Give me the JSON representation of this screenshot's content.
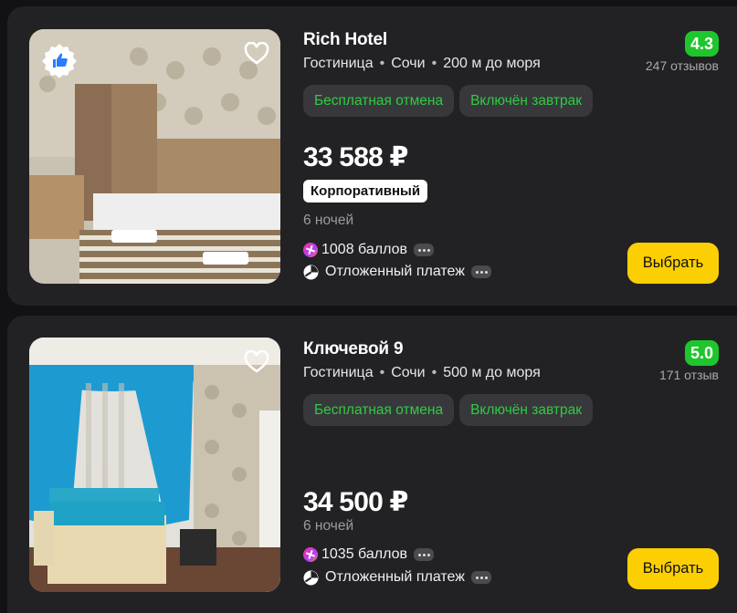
{
  "hotels": [
    {
      "name": "Rich Hotel",
      "type": "Гостиница",
      "city": "Сочи",
      "distance": "200 м до моря",
      "rating": "4.3",
      "reviews": "247 отзывов",
      "tags": [
        "Бесплатная отмена",
        "Включён завтрак"
      ],
      "price": "33 588 ₽",
      "badge": "Корпоративный",
      "nights": "6 ночей",
      "bonus": "1008 баллов",
      "payment": "Отложенный платеж",
      "select_label": "Выбрать"
    },
    {
      "name": "Ключевой 9",
      "type": "Гостиница",
      "city": "Сочи",
      "distance": "500 м до моря",
      "rating": "5.0",
      "reviews": "171 отзыв",
      "tags": [
        "Бесплатная отмена",
        "Включён завтрак"
      ],
      "price": "34 500 ₽",
      "nights": "6 ночей",
      "bonus": "1035 баллов",
      "payment": "Отложенный платеж",
      "select_label": "Выбрать"
    }
  ],
  "colors": {
    "rating_green": "#1fc52c",
    "tag_text_green": "#2ecc40",
    "select_button": "#fccf03",
    "card_bg": "#222225"
  },
  "icons": {
    "favorite": "heart-outline-icon",
    "like_badge": "thumbs-up-icon",
    "bonus": "plus-points-icon",
    "payment": "clock-icon",
    "more": "more-dots-icon"
  }
}
